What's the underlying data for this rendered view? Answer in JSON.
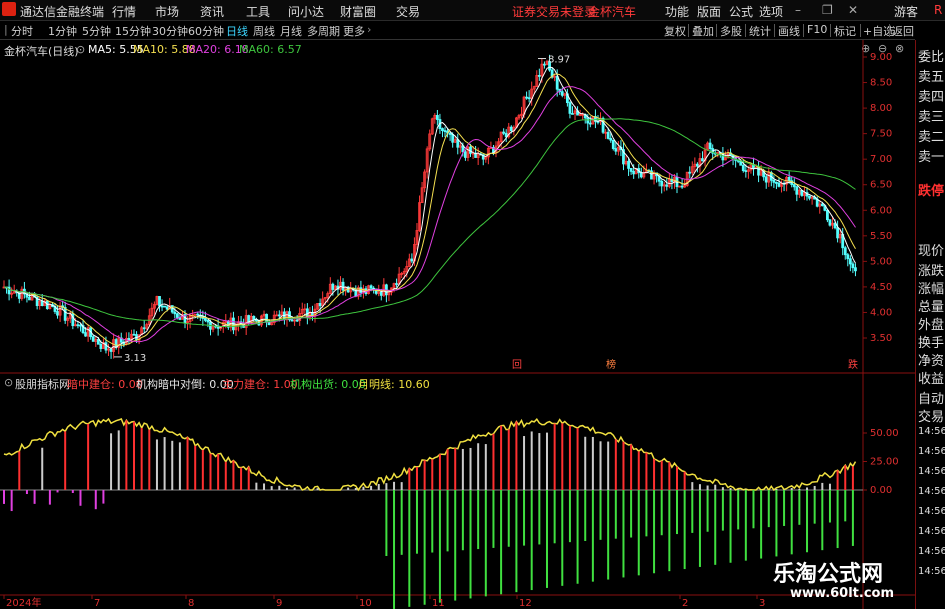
{
  "window": {
    "app_name": "通达信金融终端",
    "logo_glyph": "T"
  },
  "menu": {
    "items": [
      "行情",
      "市场",
      "资讯",
      "工具",
      "问小达",
      "财富圈",
      "交易"
    ],
    "notice": "证券交易未登录",
    "stock_name": "金杯汽车",
    "right_items": [
      "功能",
      "版面",
      "公式",
      "选项"
    ],
    "guest": "游客",
    "r_label": "R"
  },
  "toolbar": {
    "periods": [
      "分时",
      "1分钟",
      "5分钟",
      "15分钟",
      "30分钟",
      "60分钟",
      "日线",
      "周线",
      "月线",
      "多周期",
      "更多"
    ],
    "active_period": "日线",
    "right_buttons": [
      "复权",
      "叠加",
      "多股",
      "统计",
      "画线",
      "F10",
      "标记",
      "+自选",
      "返回"
    ]
  },
  "main_chart": {
    "title": "金杯汽车(日线)",
    "ma": [
      {
        "label": "MA5: 5.55",
        "color": "#ffffff"
      },
      {
        "label": "MA10: 5.88",
        "color": "#f5e050"
      },
      {
        "label": "MA20: 6.18",
        "color": "#e040e0"
      },
      {
        "label": "MA60: 6.57",
        "color": "#3ec43e"
      }
    ],
    "high_label": "8.97",
    "low_label": "3.13",
    "y_ticks": [
      "9.00",
      "8.50",
      "8.00",
      "7.50",
      "7.00",
      "6.50",
      "6.00",
      "5.50",
      "5.00",
      "4.50",
      "4.00",
      "3.50"
    ],
    "markers": [
      "回",
      "榜",
      "跌"
    ]
  },
  "indicator": {
    "name": "股朋指标网",
    "items": [
      {
        "label": "暗中建仓: 0.00",
        "color": "#ff4040"
      },
      {
        "label": "机构暗中对倒: 0.00",
        "color": "#e6e6e6"
      },
      {
        "label": "主力建仓: 1.00",
        "color": "#ff4040"
      },
      {
        "label": "机构出货: 0.00",
        "color": "#40e040"
      },
      {
        "label": "月明线: 10.60",
        "color": "#f0e040"
      }
    ],
    "y_ticks": [
      "50.00",
      "25.00",
      "0.00"
    ]
  },
  "x_axis": [
    "2024年",
    "7",
    "8",
    "9",
    "10",
    "11",
    "12",
    "2",
    "3"
  ],
  "right_panel": {
    "order_book": [
      "委比",
      "卖五",
      "卖四",
      "卖三",
      "卖二",
      "卖一"
    ],
    "stop_label": "跌停",
    "quote": [
      "现价",
      "涨跌",
      "涨幅",
      "总量",
      "外盘",
      "换手",
      "净资",
      "收益"
    ],
    "tabs": [
      "自动",
      "交易"
    ],
    "times": [
      "14:56",
      "14:56",
      "14:56",
      "14:56",
      "14:56",
      "14:56",
      "14:56",
      "14:56"
    ]
  },
  "watermark": {
    "title": "乐淘公式网",
    "url": "www.60lt.com"
  }
}
